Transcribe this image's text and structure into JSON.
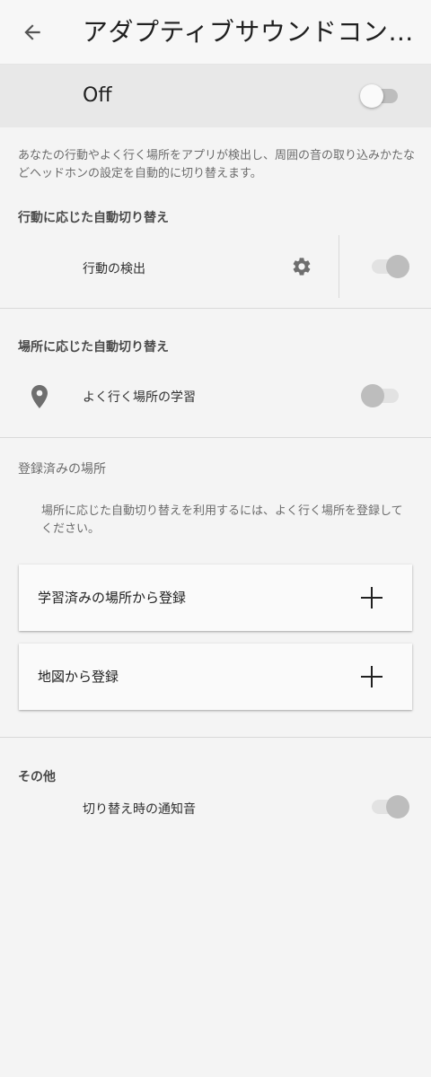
{
  "app_bar": {
    "title": "アダプティブサウンドコントロ…",
    "back_icon": "arrow-back-icon"
  },
  "master": {
    "label": "Off",
    "enabled": false
  },
  "description": "あなたの行動やよく行く場所をアプリが検出し、周囲の音の取り込みかたなどヘッドホンの設定を自動的に切り替えます。",
  "sections": {
    "activity": {
      "header": "行動に応じた自動切り替え",
      "item_label": "行動の検出",
      "settings_icon": "gear-icon",
      "toggle_on": true,
      "toggle_disabled": true
    },
    "location": {
      "header": "場所に応じた自動切り替え",
      "item_icon": "location-pin-icon",
      "item_label": "よく行く場所の学習",
      "toggle_on": false,
      "toggle_disabled": true
    },
    "registered": {
      "header": "登録済みの場所",
      "hint": "場所に応じた自動切り替えを利用するには、よく行く場所を登録してください。",
      "buttons": [
        {
          "label": "学習済みの場所から登録",
          "icon": "plus-icon"
        },
        {
          "label": "地図から登録",
          "icon": "plus-icon"
        }
      ]
    },
    "other": {
      "header": "その他",
      "item_label": "切り替え時の通知音",
      "toggle_on": true,
      "toggle_disabled": true
    }
  },
  "colors": {
    "background": "#f4f4f4",
    "app_bar": "#f7f7f7",
    "master_bar": "#e8e8e8",
    "card": "#fafafa",
    "icon_gray": "#757575"
  }
}
